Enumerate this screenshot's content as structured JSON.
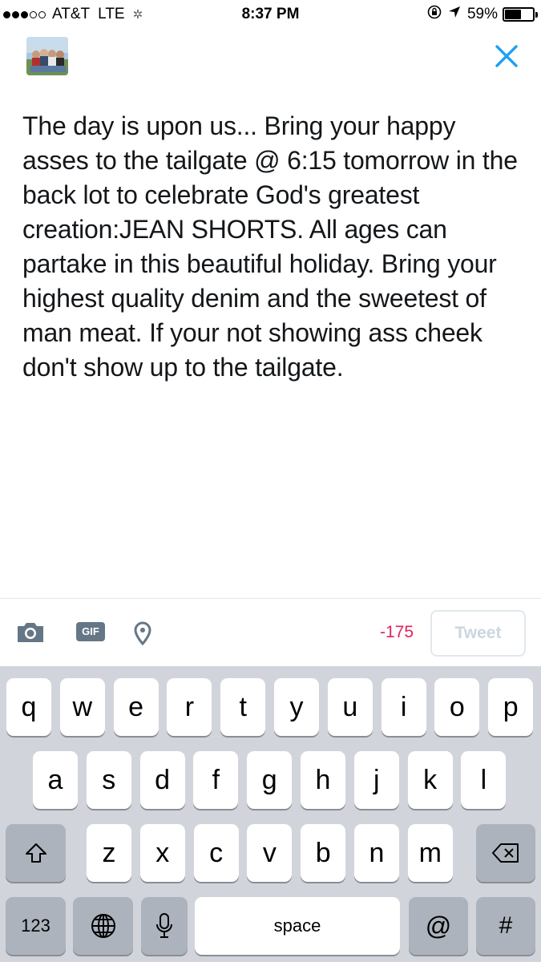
{
  "status_bar": {
    "carrier": "AT&T",
    "network": "LTE",
    "time": "8:37 PM",
    "battery_text": "59%",
    "battery_level": 0.59,
    "signal_bars_filled": 3,
    "signal_bars_total": 5
  },
  "compose": {
    "text": "The day is upon us... Bring your happy asses to the tailgate @ 6:15 tomorrow in the back lot to celebrate God's greatest creation:JEAN SHORTS. All ages can partake in this beautiful holiday. Bring your highest quality denim and the sweetest of man meat. If your not showing ass cheek don't show up to the tailgate."
  },
  "toolbar": {
    "gif_label": "GIF",
    "char_count": "-175",
    "tweet_label": "Tweet"
  },
  "keyboard": {
    "row1": [
      "q",
      "w",
      "e",
      "r",
      "t",
      "y",
      "u",
      "i",
      "o",
      "p"
    ],
    "row2": [
      "a",
      "s",
      "d",
      "f",
      "g",
      "h",
      "j",
      "k",
      "l"
    ],
    "row3": [
      "z",
      "x",
      "c",
      "v",
      "b",
      "n",
      "m"
    ],
    "numbers_label": "123",
    "space_label": "space",
    "at_label": "@",
    "hash_label": "#"
  },
  "colors": {
    "accent": "#1da1f2",
    "char_count_negative": "#e0245e",
    "keyboard_bg": "#d1d5db"
  }
}
